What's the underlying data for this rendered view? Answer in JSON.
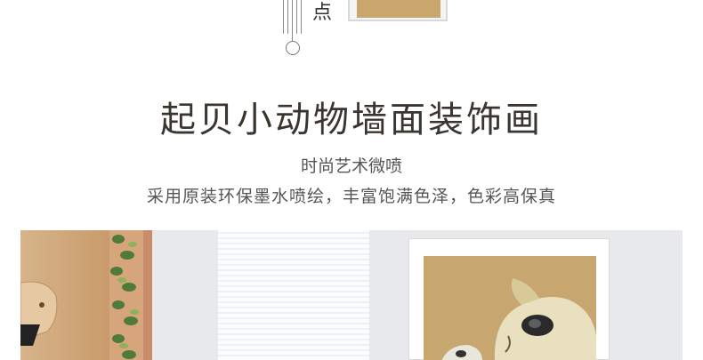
{
  "top": {
    "feature_label": "点"
  },
  "heading": {
    "title": "起贝小动物墙面装饰画",
    "subtitle": "时尚艺术微喷",
    "description": "采用原装环保墨水喷绘，丰富饱满色泽，色彩高保真"
  },
  "colors": {
    "title": "#3b3530",
    "text": "#555555",
    "art_background": "#c8a670"
  },
  "icons": [
    "circle-marker-icon",
    "vertical-lines-decoration"
  ]
}
